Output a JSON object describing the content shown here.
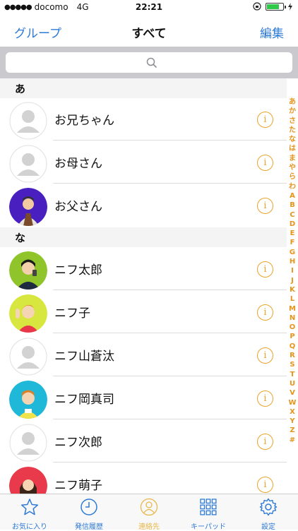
{
  "status_bar": {
    "carrier": "docomo",
    "network": "4G",
    "time": "22:21",
    "battery_percent": 70
  },
  "nav": {
    "left": "グループ",
    "title": "すべて",
    "right": "編集"
  },
  "search": {
    "placeholder": ""
  },
  "sections": [
    {
      "header": "あ",
      "contacts": [
        "お兄ちゃん",
        "お母さん",
        "お父さん"
      ]
    },
    {
      "header": "な",
      "contacts": [
        "ニフ太郎",
        "ニフ子",
        "ニフ山蒼汰",
        "ニフ岡真司",
        "ニフ次郎",
        "ニフ萌子"
      ]
    }
  ],
  "info_glyph": "i",
  "index": [
    "あ",
    "か",
    "さ",
    "た",
    "な",
    "は",
    "ま",
    "や",
    "ら",
    "わ",
    "A",
    "B",
    "C",
    "D",
    "E",
    "F",
    "G",
    "H",
    "I",
    "J",
    "K",
    "L",
    "M",
    "N",
    "O",
    "P",
    "Q",
    "R",
    "S",
    "T",
    "U",
    "V",
    "W",
    "X",
    "Y",
    "Z",
    "#"
  ],
  "tabs": [
    {
      "label": "お気に入り",
      "icon": "star-icon"
    },
    {
      "label": "発信履歴",
      "icon": "clock-icon"
    },
    {
      "label": "連絡先",
      "icon": "person-icon",
      "active": true
    },
    {
      "label": "キーパッド",
      "icon": "keypad-icon"
    },
    {
      "label": "設定",
      "icon": "gear-icon"
    }
  ],
  "colors": {
    "accent_blue": "#2d7ad6",
    "accent_orange": "#e8a32a",
    "active_tab": "#e8b84a"
  }
}
